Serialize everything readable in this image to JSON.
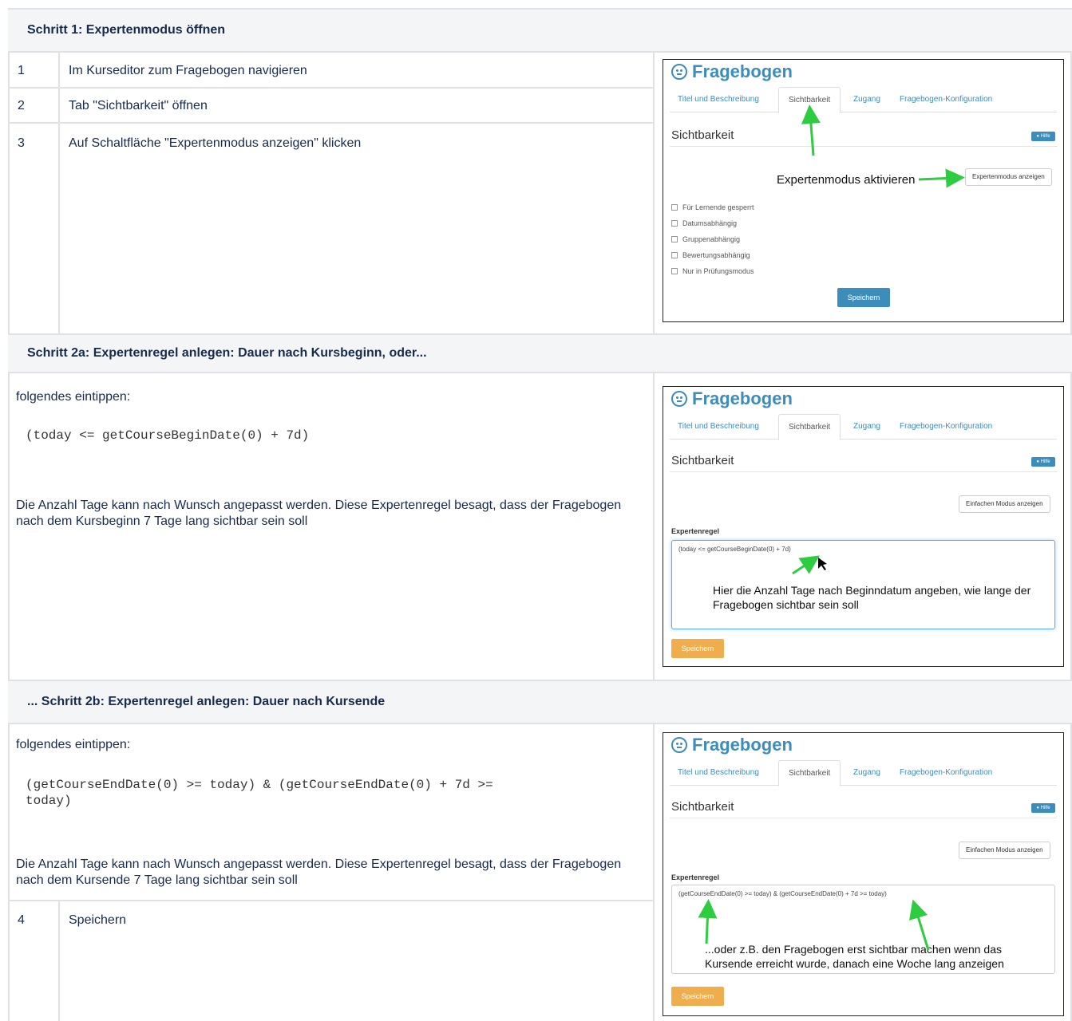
{
  "step1": {
    "header": "Schritt 1: Expertenmodus öffnen",
    "rows": [
      {
        "num": "1",
        "text": "Im Kurseditor zum Fragebogen navigieren"
      },
      {
        "num": "2",
        "text": "Tab \"Sichtbarkeit\" öffnen"
      },
      {
        "num": "3",
        "text": "Auf Schaltfläche \"Expertenmodus anzeigen\" klicken"
      }
    ],
    "screenshot": {
      "title": "Fragebogen",
      "tabs": [
        "Titel und Beschreibung",
        "Sichtbarkeit",
        "Zugang",
        "Fragebogen-Konfiguration"
      ],
      "section": "Sichtbarkeit",
      "hilfe": "Hilfe",
      "annotation": "Expertenmodus aktivieren",
      "expert_button": "Expertenmodus anzeigen",
      "checkboxes": [
        "Für Lernende gesperrt",
        "Datumsabhängig",
        "Gruppenabhängig",
        "Bewertungsabhängig",
        "Nur in Prüfungsmodus"
      ],
      "save": "Speichern"
    }
  },
  "step2a": {
    "header": "Schritt 2a: Expertenregel anlegen: Dauer nach Kursbeginn, oder...",
    "intro": "folgendes eintippen:",
    "code": "(today <= getCourseBeginDate(0) + 7d)",
    "description": "Die Anzahl Tage kann nach Wunsch angepasst werden. Diese Expertenregel besagt, dass der Fragebogen nach dem Kursbeginn 7 Tage lang sichtbar sein soll",
    "screenshot": {
      "title": "Fragebogen",
      "tabs": [
        "Titel und Beschreibung",
        "Sichtbarkeit",
        "Zugang",
        "Fragebogen-Konfiguration"
      ],
      "section": "Sichtbarkeit",
      "hilfe": "Hilfe",
      "simple_button": "Einfachen Modus anzeigen",
      "rule_label": "Expertenregel",
      "rule": "(today <= getCourseBeginDate(0) + 7d)",
      "annotation": "Hier die Anzahl Tage nach Beginndatum angeben, wie lange der Fragebogen sichtbar sein soll",
      "save": "Speichern"
    }
  },
  "step2b": {
    "header": "... Schritt 2b: Expertenregel anlegen: Dauer nach Kursende",
    "intro": "folgendes eintippen:",
    "code": "(getCourseEndDate(0) >= today) & (getCourseEndDate(0) + 7d >=\ntoday)",
    "description": "Die Anzahl Tage kann nach Wunsch angepasst werden. Diese Expertenregel besagt, dass der Fragebogen nach dem Kursende 7 Tage lang sichtbar sein soll",
    "row4": {
      "num": "4",
      "text": "Speichern"
    },
    "screenshot": {
      "title": "Fragebogen",
      "tabs": [
        "Titel und Beschreibung",
        "Sichtbarkeit",
        "Zugang",
        "Fragebogen-Konfiguration"
      ],
      "section": "Sichtbarkeit",
      "hilfe": "Hilfe",
      "simple_button": "Einfachen Modus anzeigen",
      "rule_label": "Expertenregel",
      "rule": "(getCourseEndDate(0) >= today) & (getCourseEndDate(0) + 7d >= today)",
      "annotation": "...oder z.B. den Fragebogen erst sichtbar machen wenn das Kursende erreicht wurde, danach eine Woche lang anzeigen",
      "save": "Speichern"
    }
  },
  "colors": {
    "arrow": "#2ecc40",
    "accent": "#3c8dbc",
    "warning": "#f0ad4e"
  }
}
